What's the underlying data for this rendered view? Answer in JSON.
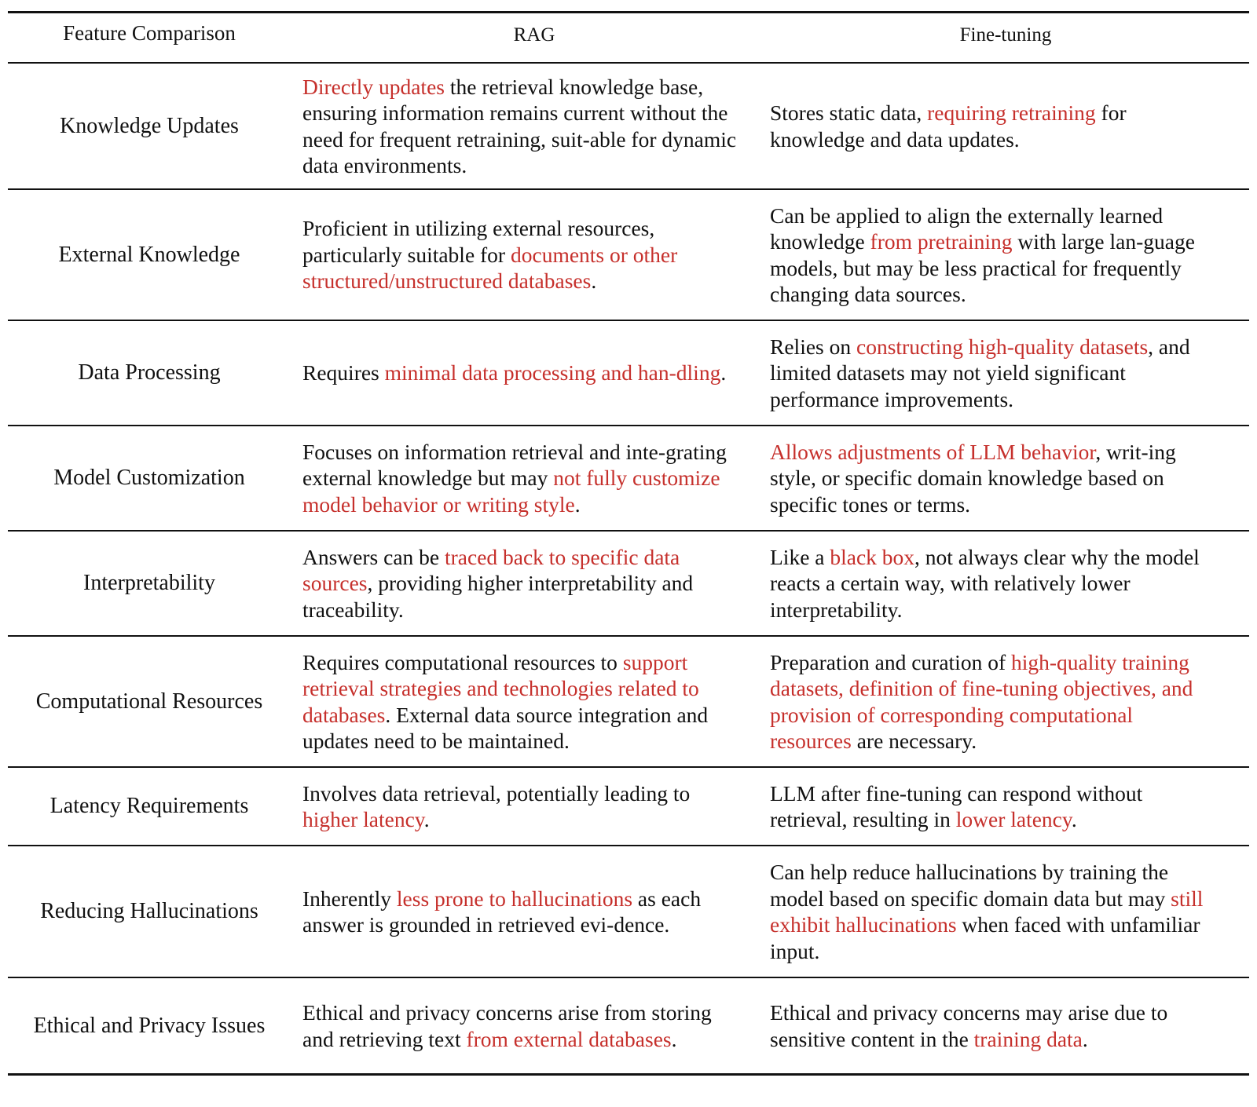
{
  "colors": {
    "highlight": "#c6302c",
    "text": "#111111",
    "rule": "#111111"
  },
  "header": {
    "feature": "Feature Comparison",
    "rag": "RAG",
    "finetuning": "Fine-tuning"
  },
  "rows": [
    {
      "feature": "Knowledge Updates",
      "rag": [
        {
          "t": "Directly updates",
          "h": true
        },
        {
          "t": " the retrieval knowledge base, ensuring information remains current without the need for frequent retraining, suit-able for dynamic data environments.",
          "h": false
        }
      ],
      "ft": [
        {
          "t": "Stores static data, ",
          "h": false
        },
        {
          "t": "requiring retraining",
          "h": true
        },
        {
          "t": " for knowledge and data updates.",
          "h": false
        }
      ]
    },
    {
      "feature": "External Knowledge",
      "rag": [
        {
          "t": "Proficient in utilizing external resources, particularly suitable for ",
          "h": false
        },
        {
          "t": "documents or other structured/unstructured databases",
          "h": true
        },
        {
          "t": ".",
          "h": false
        }
      ],
      "ft": [
        {
          "t": "Can be applied to align the externally learned knowledge ",
          "h": false
        },
        {
          "t": "from pretraining",
          "h": true
        },
        {
          "t": " with large lan-guage models, but may be less practical for frequently changing data sources.",
          "h": false
        }
      ]
    },
    {
      "feature": "Data Processing",
      "rag": [
        {
          "t": "Requires ",
          "h": false
        },
        {
          "t": "minimal data processing and han-dling",
          "h": true
        },
        {
          "t": ".",
          "h": false
        }
      ],
      "ft": [
        {
          "t": "Relies on ",
          "h": false
        },
        {
          "t": "constructing high-quality datasets",
          "h": true
        },
        {
          "t": ", and limited datasets may not yield significant performance improvements.",
          "h": false
        }
      ]
    },
    {
      "feature": "Model Customization",
      "rag": [
        {
          "t": "Focuses on information retrieval and inte-grating external knowledge but may ",
          "h": false
        },
        {
          "t": "not fully customize model behavior or writing style",
          "h": true
        },
        {
          "t": ".",
          "h": false
        }
      ],
      "ft": [
        {
          "t": "Allows adjustments of LLM behavior",
          "h": true
        },
        {
          "t": ", writ-ing style, or specific domain knowledge based on specific tones or terms.",
          "h": false
        }
      ]
    },
    {
      "feature": "Interpretability",
      "rag": [
        {
          "t": "Answers can be ",
          "h": false
        },
        {
          "t": "traced back to specific data sources",
          "h": true
        },
        {
          "t": ", providing higher interpretability and traceability.",
          "h": false
        }
      ],
      "ft": [
        {
          "t": "Like a ",
          "h": false
        },
        {
          "t": "black box",
          "h": true
        },
        {
          "t": ", not always clear why the model reacts a certain way, with relatively lower interpretability.",
          "h": false
        }
      ]
    },
    {
      "feature": "Computational Resources",
      "rag": [
        {
          "t": "Requires computational resources to ",
          "h": false
        },
        {
          "t": "support retrieval strategies and technologies related to databases",
          "h": true
        },
        {
          "t": ". External data source integration and updates need to be maintained.",
          "h": false
        }
      ],
      "ft": [
        {
          "t": "Preparation and curation of ",
          "h": false
        },
        {
          "t": "high-quality training datasets, definition of fine-tuning objectives, and provision of corresponding computational resources",
          "h": true
        },
        {
          "t": " are necessary.",
          "h": false
        }
      ]
    },
    {
      "feature": "Latency Requirements",
      "rag": [
        {
          "t": "Involves data retrieval, potentially leading to ",
          "h": false
        },
        {
          "t": "higher latency",
          "h": true
        },
        {
          "t": ".",
          "h": false
        }
      ],
      "ft": [
        {
          "t": "LLM after fine-tuning can respond without retrieval, resulting in ",
          "h": false
        },
        {
          "t": "lower latency",
          "h": true
        },
        {
          "t": ".",
          "h": false
        }
      ]
    },
    {
      "feature": "Reducing Hallucinations",
      "rag": [
        {
          "t": "Inherently ",
          "h": false
        },
        {
          "t": "less prone to hallucinations",
          "h": true
        },
        {
          "t": " as each answer is grounded in retrieved evi-dence.",
          "h": false
        }
      ],
      "ft": [
        {
          "t": "Can help reduce hallucinations by training the model based on specific domain data but may ",
          "h": false
        },
        {
          "t": "still exhibit hallucinations",
          "h": true
        },
        {
          "t": " when faced with unfamiliar input.",
          "h": false
        }
      ]
    },
    {
      "feature": "Ethical and Privacy Issues",
      "rag": [
        {
          "t": "Ethical and privacy concerns arise from storing and retrieving text ",
          "h": false
        },
        {
          "t": "from external databases",
          "h": true
        },
        {
          "t": ".",
          "h": false
        }
      ],
      "ft": [
        {
          "t": "Ethical and privacy concerns may arise due to sensitive content in the ",
          "h": false
        },
        {
          "t": "training data",
          "h": true
        },
        {
          "t": ".",
          "h": false
        }
      ]
    }
  ]
}
